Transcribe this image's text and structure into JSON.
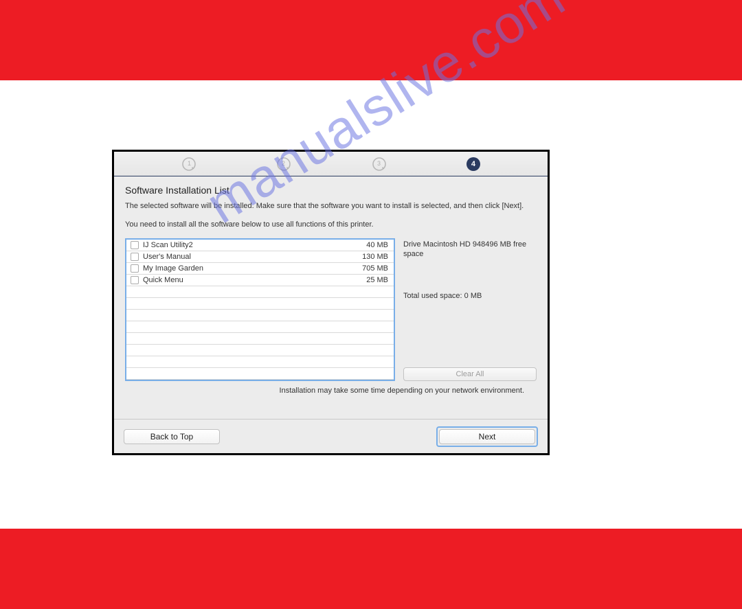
{
  "watermark": "manualslive.com",
  "steps": {
    "active_index": 4,
    "active_label": "4"
  },
  "title": "Software Installation List",
  "para1": "The selected software will be installed. Make sure that the software you want to install is selected, and then click [Next].",
  "para2": "You need to install all the software below to use all functions of this printer.",
  "items": [
    {
      "name": "IJ Scan Utility2",
      "size": "40 MB"
    },
    {
      "name": "User's Manual",
      "size": "130 MB"
    },
    {
      "name": "My Image Garden",
      "size": "705 MB"
    },
    {
      "name": "Quick Menu",
      "size": "25 MB"
    }
  ],
  "drive_info": "Drive Macintosh HD 948496 MB free space",
  "total_used": "Total used space: 0 MB",
  "clear_all": "Clear All",
  "footer_note": "Installation may take some time depending on your network environment.",
  "back_label": "Back to Top",
  "next_label": "Next"
}
